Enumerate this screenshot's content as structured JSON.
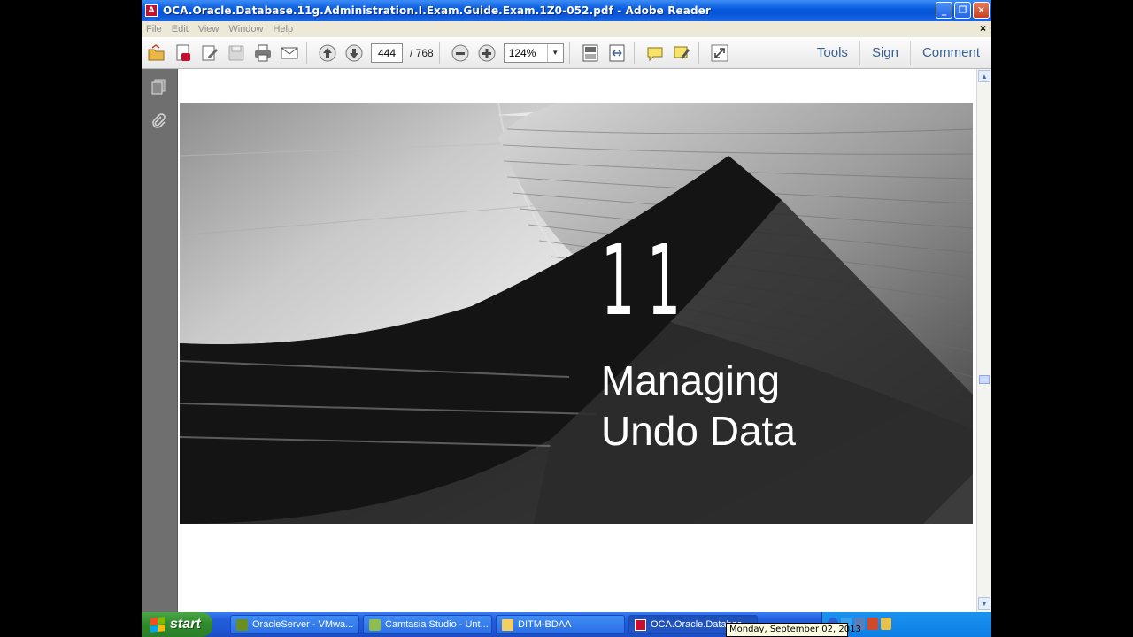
{
  "window": {
    "title": "OCA.Oracle.Database.11g.Administration.I.Exam.Guide.Exam.1Z0-052.pdf - Adobe Reader",
    "app_icon": "pdf-icon",
    "controls": [
      "minimize",
      "restore",
      "close"
    ]
  },
  "menu": {
    "items": [
      "File",
      "Edit",
      "View",
      "Window",
      "Help"
    ],
    "close_doc": "×"
  },
  "toolbar": {
    "current_page": "444",
    "total_pages": "/  768",
    "zoom": "124%",
    "links": {
      "tools": "Tools",
      "sign": "Sign",
      "comment": "Comment"
    }
  },
  "document": {
    "chapter_number": "11",
    "chapter_title_line1": "Managing",
    "chapter_title_line2": "Undo Data"
  },
  "taskbar": {
    "start_label": "start",
    "tasks": [
      {
        "label": "OracleServer - VMwa..."
      },
      {
        "label": "Camtasia Studio - Unt..."
      },
      {
        "label": "DITM-BDAA"
      },
      {
        "label": "OCA.Oracle.Databas..."
      }
    ],
    "datetime_tooltip": "Monday, September 02, 2013"
  },
  "colors": {
    "titlebar": "#0553d6",
    "toolbar_bg": "#f0f0f0",
    "nav_panel": "#6f6f6f",
    "link_text": "#3a5f8d",
    "start_green": "#2f8a2d"
  }
}
